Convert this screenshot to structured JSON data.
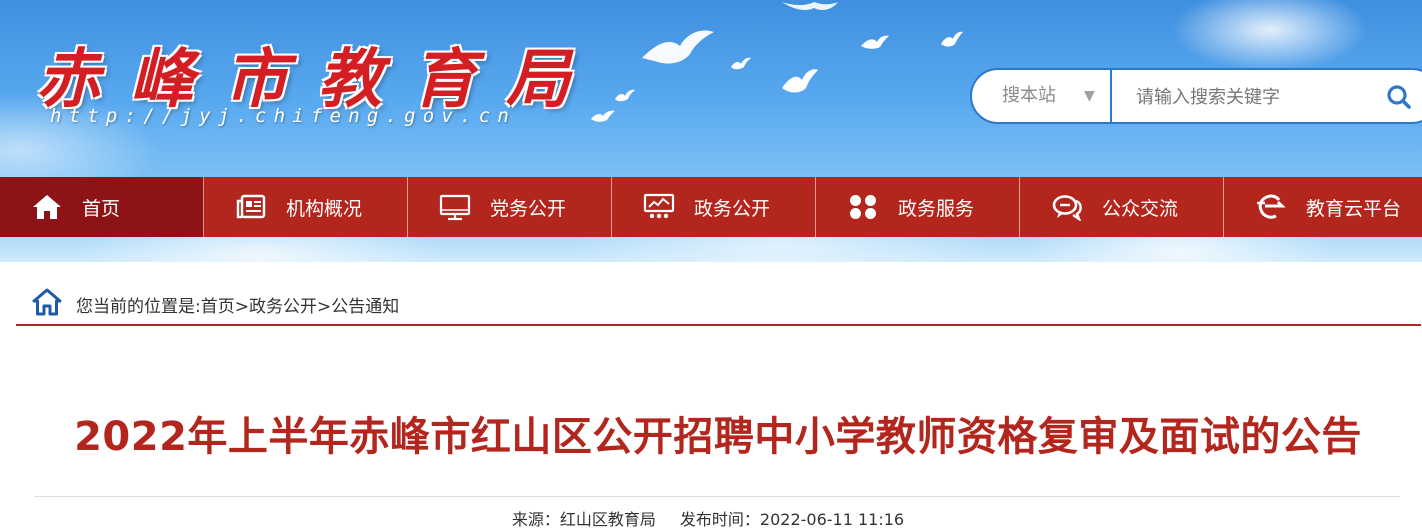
{
  "header": {
    "site_title": "赤峰市教育局",
    "site_url": "http://jyj.chifeng.gov.cn"
  },
  "search": {
    "scope_label": "搜本站",
    "placeholder": "请输入搜索关键字"
  },
  "nav": {
    "items": [
      {
        "label": "首页",
        "icon": "home-icon",
        "active": true
      },
      {
        "label": "机构概况",
        "icon": "organization-icon"
      },
      {
        "label": "党务公开",
        "icon": "monitor-icon"
      },
      {
        "label": "政务公开",
        "icon": "presentation-icon"
      },
      {
        "label": "政务服务",
        "icon": "grid-icon"
      },
      {
        "label": "公众交流",
        "icon": "chat-icon"
      },
      {
        "label": "教育云平台",
        "icon": "cloud-platform-icon"
      }
    ]
  },
  "breadcrumb": {
    "prefix": "您当前的位置是:",
    "items": [
      "首页",
      "政务公开",
      "公告通知"
    ],
    "separator": ">"
  },
  "article": {
    "title": "2022年上半年赤峰市红山区公开招聘中小学教师资格复审及面试的公告",
    "source": "来源：红山区教育局",
    "publish_time": "发布时间：2022-06-11 11:16"
  },
  "colors": {
    "nav_bg": "#b3261e",
    "nav_active": "#8c1416",
    "title_red": "#b3261e",
    "search_border": "#2f77c7"
  }
}
